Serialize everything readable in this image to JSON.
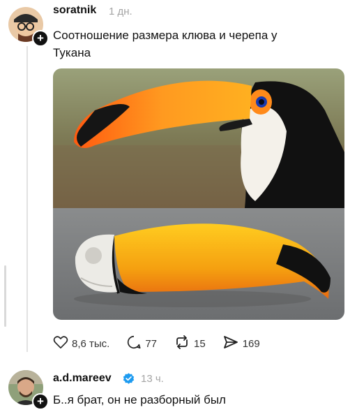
{
  "post": {
    "username": "soratnik",
    "time": "1 дн.",
    "text": "Соотношение размера клюва и черепа у Тукана",
    "follow_symbol": "+",
    "media_description_icon": "image",
    "actions": {
      "likes": "8,6 тыс.",
      "comments": "77",
      "reposts": "15",
      "shares": "169"
    }
  },
  "reply": {
    "username": "a.d.mareev",
    "verified": true,
    "time": "13 ч.",
    "text": "Б..я брат, он не разборный был",
    "follow_symbol": "+"
  },
  "icons": {
    "like": "heart-icon",
    "comment": "comment-icon",
    "repost": "repost-icon",
    "share": "send-icon",
    "verified": "verified-badge-icon"
  },
  "colors": {
    "verified": "#1d9bf0",
    "muted": "#a4a4a4"
  }
}
